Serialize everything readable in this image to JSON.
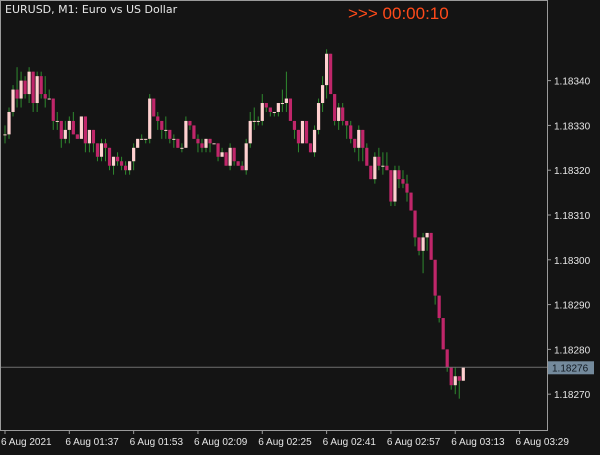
{
  "symbol_header": "EURUSD, M1:  Euro vs US Dollar",
  "countdown": {
    "prefix": ">>>",
    "time": "00:00:10",
    "color": "#ff4a1a"
  },
  "colors": {
    "background": "#141414",
    "frame": "#9a9a9a",
    "axis_text": "#e6e6e6",
    "bull": "#ffd0d0",
    "bear": "#c0266a",
    "wick": "#2f8a2f",
    "price_line": "#6e6e6e",
    "price_tag_bg": "#748a9c",
    "price_tag_text": "#101820"
  },
  "chart_data": {
    "type": "candlestick",
    "symbol": "EURUSD",
    "timeframe": "M1",
    "description": "Euro vs US Dollar",
    "ylim": [
      1.18262,
      1.18358
    ],
    "y_ticks": [
      "1.18340",
      "1.18330",
      "1.18320",
      "1.18310",
      "1.18300",
      "1.18290",
      "1.18280",
      "1.18270"
    ],
    "y_tick_values": [
      1.1834,
      1.1833,
      1.1832,
      1.1831,
      1.183,
      1.1829,
      1.1828,
      1.1827
    ],
    "x_ticks": [
      "6 Aug 2021",
      "6 Aug 01:37",
      "6 Aug 01:53",
      "6 Aug 02:09",
      "6 Aug 02:25",
      "6 Aug 02:41",
      "6 Aug 02:57",
      "6 Aug 03:13",
      "6 Aug 03:29"
    ],
    "x_tick_bars": [
      0,
      16,
      32,
      48,
      64,
      80,
      96,
      112,
      128
    ],
    "current_price": 1.18276,
    "current_price_label": "1.18276",
    "ohlc": [
      [
        1.18328,
        1.1833,
        1.18326,
        1.18328
      ],
      [
        1.18328,
        1.18334,
        1.18327,
        1.18333
      ],
      [
        1.18333,
        1.18339,
        1.18332,
        1.18338
      ],
      [
        1.18338,
        1.18343,
        1.18334,
        1.18336
      ],
      [
        1.18336,
        1.18342,
        1.18334,
        1.1834
      ],
      [
        1.1834,
        1.18341,
        1.18336,
        1.18337
      ],
      [
        1.18337,
        1.18343,
        1.18335,
        1.18342
      ],
      [
        1.18342,
        1.18342,
        1.18333,
        1.18335
      ],
      [
        1.18335,
        1.18342,
        1.18333,
        1.18341
      ],
      [
        1.18341,
        1.18342,
        1.18336,
        1.18337
      ],
      [
        1.18337,
        1.18341,
        1.18334,
        1.18336
      ],
      [
        1.18336,
        1.18338,
        1.18336,
        1.18336
      ],
      [
        1.18336,
        1.18336,
        1.18329,
        1.18331
      ],
      [
        1.18331,
        1.18333,
        1.18329,
        1.18331
      ],
      [
        1.18331,
        1.18331,
        1.18325,
        1.18327
      ],
      [
        1.18327,
        1.18331,
        1.18326,
        1.18329
      ],
      [
        1.18329,
        1.18332,
        1.18326,
        1.18331
      ],
      [
        1.18331,
        1.18333,
        1.18328,
        1.18328
      ],
      [
        1.18328,
        1.18328,
        1.18327,
        1.18327
      ],
      [
        1.18327,
        1.18332,
        1.18327,
        1.18332
      ],
      [
        1.18332,
        1.18332,
        1.18324,
        1.18326
      ],
      [
        1.18326,
        1.18329,
        1.18324,
        1.18329
      ],
      [
        1.18329,
        1.18329,
        1.18324,
        1.18326
      ],
      [
        1.18326,
        1.18326,
        1.18322,
        1.18323
      ],
      [
        1.18323,
        1.18327,
        1.18322,
        1.18326
      ],
      [
        1.18326,
        1.18327,
        1.18322,
        1.18325
      ],
      [
        1.18325,
        1.18325,
        1.1832,
        1.18321
      ],
      [
        1.18321,
        1.18323,
        1.18319,
        1.18323
      ],
      [
        1.18323,
        1.18324,
        1.18321,
        1.18322
      ],
      [
        1.18322,
        1.18323,
        1.1832,
        1.18321
      ],
      [
        1.18321,
        1.18322,
        1.18319,
        1.1832
      ],
      [
        1.1832,
        1.18322,
        1.18319,
        1.18322
      ],
      [
        1.18322,
        1.18326,
        1.1832,
        1.18325
      ],
      [
        1.18325,
        1.18327,
        1.18325,
        1.18327
      ],
      [
        1.18327,
        1.18328,
        1.18327,
        1.18327
      ],
      [
        1.18327,
        1.18327,
        1.18326,
        1.18327
      ],
      [
        1.18327,
        1.18337,
        1.18326,
        1.18336
      ],
      [
        1.18336,
        1.18336,
        1.18332,
        1.18332
      ],
      [
        1.18332,
        1.18333,
        1.18329,
        1.18331
      ],
      [
        1.18331,
        1.18331,
        1.18327,
        1.18329
      ],
      [
        1.18329,
        1.18332,
        1.18327,
        1.18329
      ],
      [
        1.18329,
        1.18329,
        1.18326,
        1.18327
      ],
      [
        1.18327,
        1.18328,
        1.18325,
        1.18327
      ],
      [
        1.18327,
        1.18327,
        1.18325,
        1.18325
      ],
      [
        1.18325,
        1.18326,
        1.18324,
        1.18325
      ],
      [
        1.18325,
        1.18332,
        1.18325,
        1.18331
      ],
      [
        1.18331,
        1.18331,
        1.18329,
        1.1833
      ],
      [
        1.1833,
        1.1833,
        1.18327,
        1.18327
      ],
      [
        1.18327,
        1.18328,
        1.18324,
        1.18326
      ],
      [
        1.18326,
        1.18327,
        1.18324,
        1.18325
      ],
      [
        1.18325,
        1.18327,
        1.18324,
        1.18327
      ],
      [
        1.18327,
        1.18327,
        1.18324,
        1.18326
      ],
      [
        1.18326,
        1.18326,
        1.18326,
        1.18326
      ],
      [
        1.18326,
        1.18326,
        1.18322,
        1.18323
      ],
      [
        1.18323,
        1.18325,
        1.18323,
        1.18324
      ],
      [
        1.18324,
        1.18324,
        1.18321,
        1.18321
      ],
      [
        1.18321,
        1.18326,
        1.1832,
        1.18325
      ],
      [
        1.18325,
        1.18325,
        1.18321,
        1.18322
      ],
      [
        1.18322,
        1.18322,
        1.18321,
        1.18321
      ],
      [
        1.18321,
        1.18322,
        1.1832,
        1.1832
      ],
      [
        1.1832,
        1.18327,
        1.18319,
        1.18326
      ],
      [
        1.18326,
        1.18333,
        1.18325,
        1.18331
      ],
      [
        1.18331,
        1.18334,
        1.18329,
        1.18331
      ],
      [
        1.18331,
        1.18332,
        1.1833,
        1.18331
      ],
      [
        1.18331,
        1.18337,
        1.1833,
        1.18335
      ],
      [
        1.18335,
        1.18335,
        1.18333,
        1.18334
      ],
      [
        1.18334,
        1.18334,
        1.18332,
        1.18333
      ],
      [
        1.18333,
        1.18333,
        1.18332,
        1.18333
      ],
      [
        1.18333,
        1.18335,
        1.18332,
        1.18335
      ],
      [
        1.18335,
        1.18338,
        1.18333,
        1.18335
      ],
      [
        1.18335,
        1.18342,
        1.18333,
        1.18336
      ],
      [
        1.18336,
        1.18336,
        1.18331,
        1.18331
      ],
      [
        1.18331,
        1.18331,
        1.18327,
        1.18329
      ],
      [
        1.18329,
        1.18329,
        1.18324,
        1.18326
      ],
      [
        1.18326,
        1.18331,
        1.18326,
        1.18331
      ],
      [
        1.18331,
        1.18331,
        1.18326,
        1.18326
      ],
      [
        1.18326,
        1.18326,
        1.18324,
        1.18324
      ],
      [
        1.18324,
        1.1833,
        1.18323,
        1.18329
      ],
      [
        1.18329,
        1.18336,
        1.18328,
        1.18335
      ],
      [
        1.18335,
        1.18341,
        1.18333,
        1.18339
      ],
      [
        1.18339,
        1.18347,
        1.18336,
        1.18346
      ],
      [
        1.18346,
        1.18346,
        1.18337,
        1.18337
      ],
      [
        1.18337,
        1.18337,
        1.1833,
        1.18331
      ],
      [
        1.18331,
        1.18335,
        1.18329,
        1.18334
      ],
      [
        1.18334,
        1.18335,
        1.1833,
        1.18331
      ],
      [
        1.18331,
        1.18331,
        1.18327,
        1.1833
      ],
      [
        1.1833,
        1.18331,
        1.18326,
        1.18327
      ],
      [
        1.18327,
        1.18327,
        1.18324,
        1.18325
      ],
      [
        1.18325,
        1.1833,
        1.18322,
        1.18329
      ],
      [
        1.18329,
        1.18329,
        1.18322,
        1.18325
      ],
      [
        1.18325,
        1.18326,
        1.18321,
        1.18321
      ],
      [
        1.18321,
        1.18321,
        1.18318,
        1.18318
      ],
      [
        1.18318,
        1.18324,
        1.18317,
        1.18323
      ],
      [
        1.18323,
        1.18325,
        1.1832,
        1.18321
      ],
      [
        1.18321,
        1.18324,
        1.18319,
        1.18321
      ],
      [
        1.18321,
        1.18324,
        1.1832,
        1.1832
      ],
      [
        1.1832,
        1.1832,
        1.18312,
        1.18313
      ],
      [
        1.18313,
        1.18321,
        1.18312,
        1.1832
      ],
      [
        1.1832,
        1.18321,
        1.18316,
        1.18318
      ],
      [
        1.18318,
        1.1832,
        1.18316,
        1.18317
      ],
      [
        1.18317,
        1.18319,
        1.18313,
        1.18315
      ],
      [
        1.18315,
        1.18315,
        1.18311,
        1.18311
      ],
      [
        1.18311,
        1.18311,
        1.18303,
        1.18305
      ],
      [
        1.18305,
        1.18305,
        1.18301,
        1.18302
      ],
      [
        1.18302,
        1.18306,
        1.18297,
        1.18305
      ],
      [
        1.18305,
        1.18306,
        1.18302,
        1.18306
      ],
      [
        1.18306,
        1.18306,
        1.183,
        1.183
      ],
      [
        1.183,
        1.183,
        1.1829,
        1.18292
      ],
      [
        1.18292,
        1.18292,
        1.18286,
        1.18287
      ],
      [
        1.18287,
        1.18287,
        1.1828,
        1.1828
      ],
      [
        1.1828,
        1.1828,
        1.18275,
        1.18276
      ],
      [
        1.18276,
        1.18276,
        1.18271,
        1.18272
      ],
      [
        1.18272,
        1.18276,
        1.1827,
        1.18274
      ],
      [
        1.18274,
        1.18274,
        1.18269,
        1.18273
      ],
      [
        1.18273,
        1.18276,
        1.18273,
        1.18276
      ]
    ]
  }
}
